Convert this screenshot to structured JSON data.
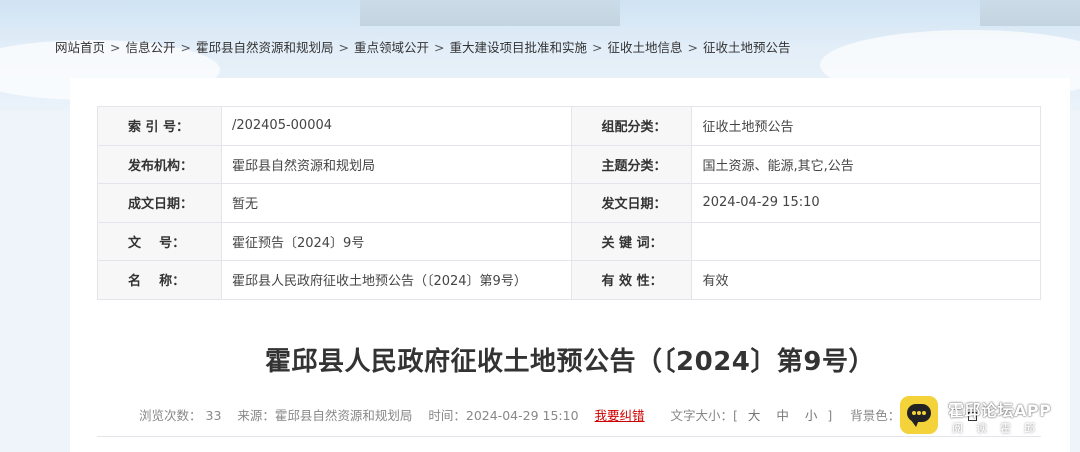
{
  "breadcrumb": [
    {
      "label": "网站首页"
    },
    {
      "label": "信息公开"
    },
    {
      "label": "霍邱县自然资源和规划局"
    },
    {
      "label": "重点领域公开"
    },
    {
      "label": "重大建设项目批准和实施"
    },
    {
      "label": "征收土地信息"
    },
    {
      "label": "征收土地预公告"
    }
  ],
  "breadcrumb_sep": ">",
  "meta": {
    "rows": [
      {
        "k1": "索 引 号：",
        "v1": "/202405-00004",
        "k2": "组配分类：",
        "v2": "征收土地预公告"
      },
      {
        "k1": "发布机构：",
        "v1": "霍邱县自然资源和规划局",
        "k2": "主题分类：",
        "v2": "国土资源、能源,其它,公告"
      },
      {
        "k1": "成文日期：",
        "v1": "暂无",
        "k2": "发文日期：",
        "v2": "2024-04-29 15:10"
      },
      {
        "k1": "文    号：",
        "v1": "霍征预告〔2024〕9号",
        "k2": "关 键 词：",
        "v2": ""
      },
      {
        "k1": "名    称：",
        "v1": "霍邱县人民政府征收土地预公告（〔2024〕第9号）",
        "k2": "有 效 性：",
        "v2": "有效"
      }
    ]
  },
  "article": {
    "title": "霍邱县人民政府征收土地预公告（〔2024〕第9号）"
  },
  "info": {
    "views_label": "浏览次数：",
    "views": "33",
    "source_label": "来源：霍邱县自然资源和规划局",
    "time_label": "时间：2024-04-29 15:10",
    "report_label": "我要纠错",
    "fontsize_label": "文字大小：[",
    "size_large": "大",
    "size_medium": "中",
    "size_small": "小",
    "fontsize_end": "]",
    "bg_label": "背景色："
  },
  "watermark": {
    "title": "霍邱论坛APP",
    "subtitle": "阅读霍邱"
  },
  "colors": {
    "report": "#cc0000",
    "watermark_logo": "#f3d23a"
  }
}
